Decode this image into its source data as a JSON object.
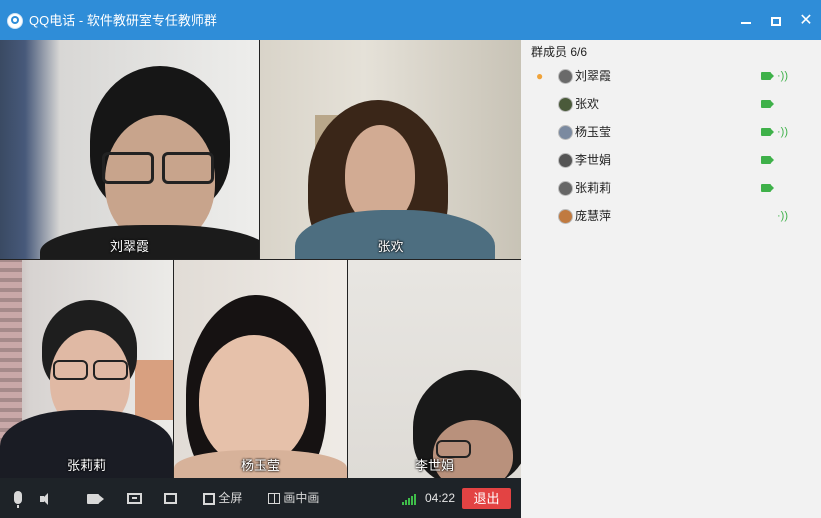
{
  "window": {
    "app_name": "QQ电话",
    "separator": "-",
    "group_name": "软件教研室专任教师群",
    "close_glyph": "✕"
  },
  "videos": [
    {
      "name": "刘翠霞"
    },
    {
      "name": "张欢"
    },
    {
      "name": "张莉莉"
    },
    {
      "name": "杨玉莹"
    },
    {
      "name": "李世娟"
    }
  ],
  "members_panel": {
    "title": "群成员 6/6",
    "members": [
      {
        "name": "刘翠霞",
        "host": true,
        "camera": true,
        "speaking": true
      },
      {
        "name": "张欢",
        "host": false,
        "camera": true,
        "speaking": false
      },
      {
        "name": "杨玉莹",
        "host": false,
        "camera": true,
        "speaking": true
      },
      {
        "name": "李世娟",
        "host": false,
        "camera": true,
        "speaking": false
      },
      {
        "name": "张莉莉",
        "host": false,
        "camera": true,
        "speaking": false
      },
      {
        "name": "庞慧萍",
        "host": false,
        "camera": false,
        "speaking": true
      }
    ]
  },
  "toolbar": {
    "fullscreen_label": "全屏",
    "pip_label": "画中画",
    "timer": "04:22",
    "exit_label": "退出"
  },
  "icons": {
    "host": "user-icon",
    "camera": "video-camera-icon",
    "speaking": "sound-wave-icon"
  },
  "colors": {
    "titlebar": "#2f8dd8",
    "status_green": "#3fb14a",
    "exit_red": "#e34343",
    "toolbar_bg": "#1e2328"
  }
}
